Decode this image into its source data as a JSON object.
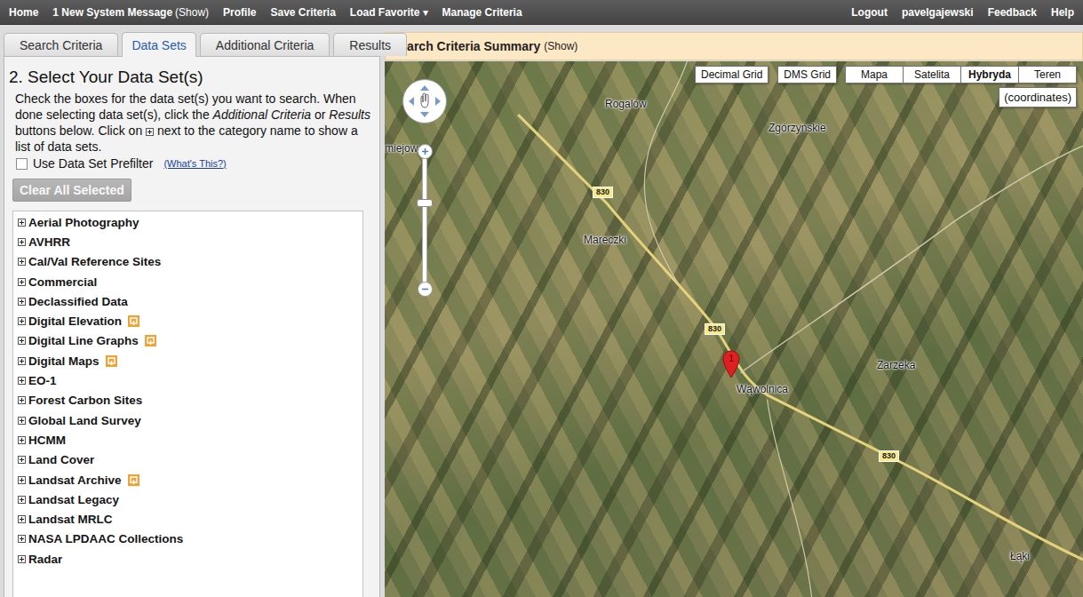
{
  "topbar": {
    "left": [
      {
        "label": "Home"
      },
      {
        "label": "1 New System Message",
        "suffix": "(Show)"
      },
      {
        "label": "Profile"
      },
      {
        "label": "Save Criteria"
      },
      {
        "label": "Load Favorite",
        "caret": "▾"
      },
      {
        "label": "Manage Criteria"
      }
    ],
    "right": [
      "Logout",
      "pavelgajewski",
      "Feedback",
      "Help"
    ]
  },
  "tabs": [
    {
      "label": "Search Criteria",
      "selected": false
    },
    {
      "label": "Data Sets",
      "selected": true
    },
    {
      "label": "Additional Criteria",
      "selected": false
    },
    {
      "label": "Results",
      "selected": false
    }
  ],
  "panel": {
    "heading": "2. Select Your Data Set(s)",
    "instructions": [
      {
        "kind": "text",
        "text": "Check the boxes for the data set(s) you want to search. When done selecting data set(s), click the ",
        "italic": false
      },
      {
        "kind": "text",
        "text": "Additional Criteria",
        "italic": true
      },
      {
        "kind": "text",
        "text": " or ",
        "italic": false
      },
      {
        "kind": "text",
        "text": "Results",
        "italic": true
      },
      {
        "kind": "text",
        "text": " buttons below. Click on ",
        "italic": false
      },
      {
        "kind": "icon"
      },
      {
        "kind": "text",
        "text": " next to the category name to show a list of data sets.",
        "italic": false
      }
    ],
    "prefilter": {
      "label": "Use Data Set Prefilter",
      "checked": false,
      "help": "(What's This?)"
    },
    "clear_button": {
      "label": "Clear All Selected",
      "disabled": true
    },
    "datasets": [
      {
        "label": "Aerial Photography",
        "expanded": false,
        "badge": false
      },
      {
        "label": "AVHRR",
        "expanded": false,
        "badge": false
      },
      {
        "label": "Cal/Val Reference Sites",
        "expanded": false,
        "badge": false
      },
      {
        "label": "Commercial",
        "expanded": false,
        "badge": false
      },
      {
        "label": "Declassified Data",
        "expanded": false,
        "badge": false
      },
      {
        "label": "Digital Elevation",
        "expanded": false,
        "badge": true
      },
      {
        "label": "Digital Line Graphs",
        "expanded": false,
        "badge": true
      },
      {
        "label": "Digital Maps",
        "expanded": false,
        "badge": true
      },
      {
        "label": "EO-1",
        "expanded": false,
        "badge": false
      },
      {
        "label": "Forest Carbon Sites",
        "expanded": false,
        "badge": false
      },
      {
        "label": "Global Land Survey",
        "expanded": false,
        "badge": false
      },
      {
        "label": "HCMM",
        "expanded": false,
        "badge": false
      },
      {
        "label": "Land Cover",
        "expanded": false,
        "badge": false
      },
      {
        "label": "Landsat Archive",
        "expanded": false,
        "badge": true
      },
      {
        "label": "Landsat Legacy",
        "expanded": false,
        "badge": false
      },
      {
        "label": "Landsat MRLC",
        "expanded": false,
        "badge": false
      },
      {
        "label": "NASA LPDAAC Collections",
        "expanded": false,
        "badge": false
      },
      {
        "label": "Radar",
        "expanded": false,
        "badge": false
      }
    ]
  },
  "summary": {
    "title": "Search Criteria Summary",
    "toggle": "(Show)"
  },
  "map": {
    "grid_buttons": [
      "Decimal Grid",
      "DMS Grid"
    ],
    "types": [
      {
        "label": "Mapa",
        "selected": false
      },
      {
        "label": "Satelita",
        "selected": false
      },
      {
        "label": "Hybryda",
        "selected": true
      },
      {
        "label": "Teren",
        "selected": false
      }
    ],
    "coordinates": "(coordinates)",
    "zoom": {
      "level": 0.65
    },
    "places": [
      "Rogalów",
      "Zgórzyńskie",
      "miejow",
      "Mareczki",
      "Wąwolnica",
      "Zarzeka",
      "Łąki"
    ],
    "road_labels": [
      "830",
      "830",
      "830"
    ],
    "markers": [
      {
        "label": "1"
      }
    ]
  }
}
